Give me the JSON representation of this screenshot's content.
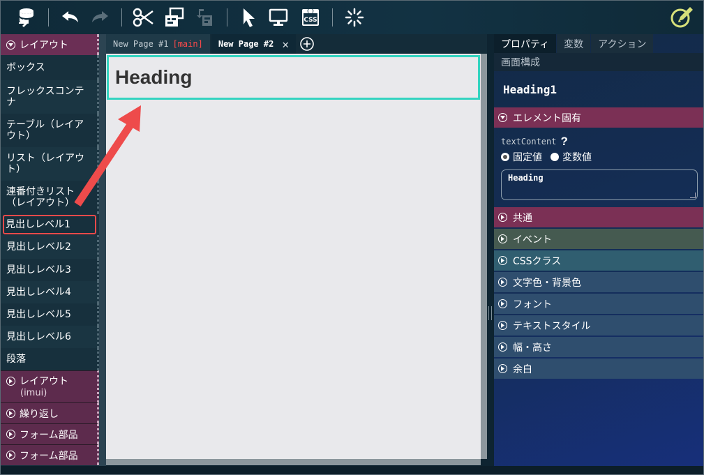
{
  "toolbar": {
    "icons": [
      "database-export-icon",
      "undo-icon",
      "redo-icon",
      "scissors-icon",
      "copy-icon",
      "paste-icon",
      "pointer-icon",
      "monitor-icon",
      "css-icon",
      "loading-icon",
      "pencil-icon"
    ],
    "css_label": "CSS"
  },
  "palette": {
    "section_layout": "レイアウト",
    "items": [
      "ボックス",
      "フレックスコンテナ",
      "テーブル（レイアウト）",
      "リスト（レイアウト）",
      "連番付きリスト（レイアウト）",
      "見出しレベル1",
      "見出しレベル2",
      "見出しレベル3",
      "見出しレベル4",
      "見出しレベル5",
      "見出しレベル6",
      "段落"
    ],
    "section_layout_imui": "レイアウト",
    "section_layout_imui_sub": "(imui)",
    "section_repeat": "繰り返し",
    "section_form": "フォーム部品",
    "section_form2": "フォーム部品"
  },
  "tabs": {
    "tab1_label": "New Page #1",
    "tab1_badge": "[main]",
    "tab2_label": "New Page #2",
    "tab2_close": "✕"
  },
  "canvas": {
    "heading_text": "Heading"
  },
  "panel": {
    "tabs": [
      "プロパティ",
      "変数",
      "アクション"
    ],
    "tab_row2": "画面構成",
    "element_title": "Heading1",
    "sections": {
      "element_specific": "エレメント固有",
      "common": "共通",
      "event": "イベント",
      "css_class": "CSSクラス",
      "color": "文字色・背景色",
      "font": "フォント",
      "text_style": "テキストスタイル",
      "size": "幅・高さ",
      "margin": "余白"
    },
    "prop_name": "textContent",
    "help": "?",
    "radio_fixed": "固定値",
    "radio_variable": "変数値",
    "text_value": "Heading"
  },
  "colors": {
    "accent_selection": "#33d4c0",
    "highlight_red": "#e84a4a",
    "arrow": "#ee4b4b"
  }
}
